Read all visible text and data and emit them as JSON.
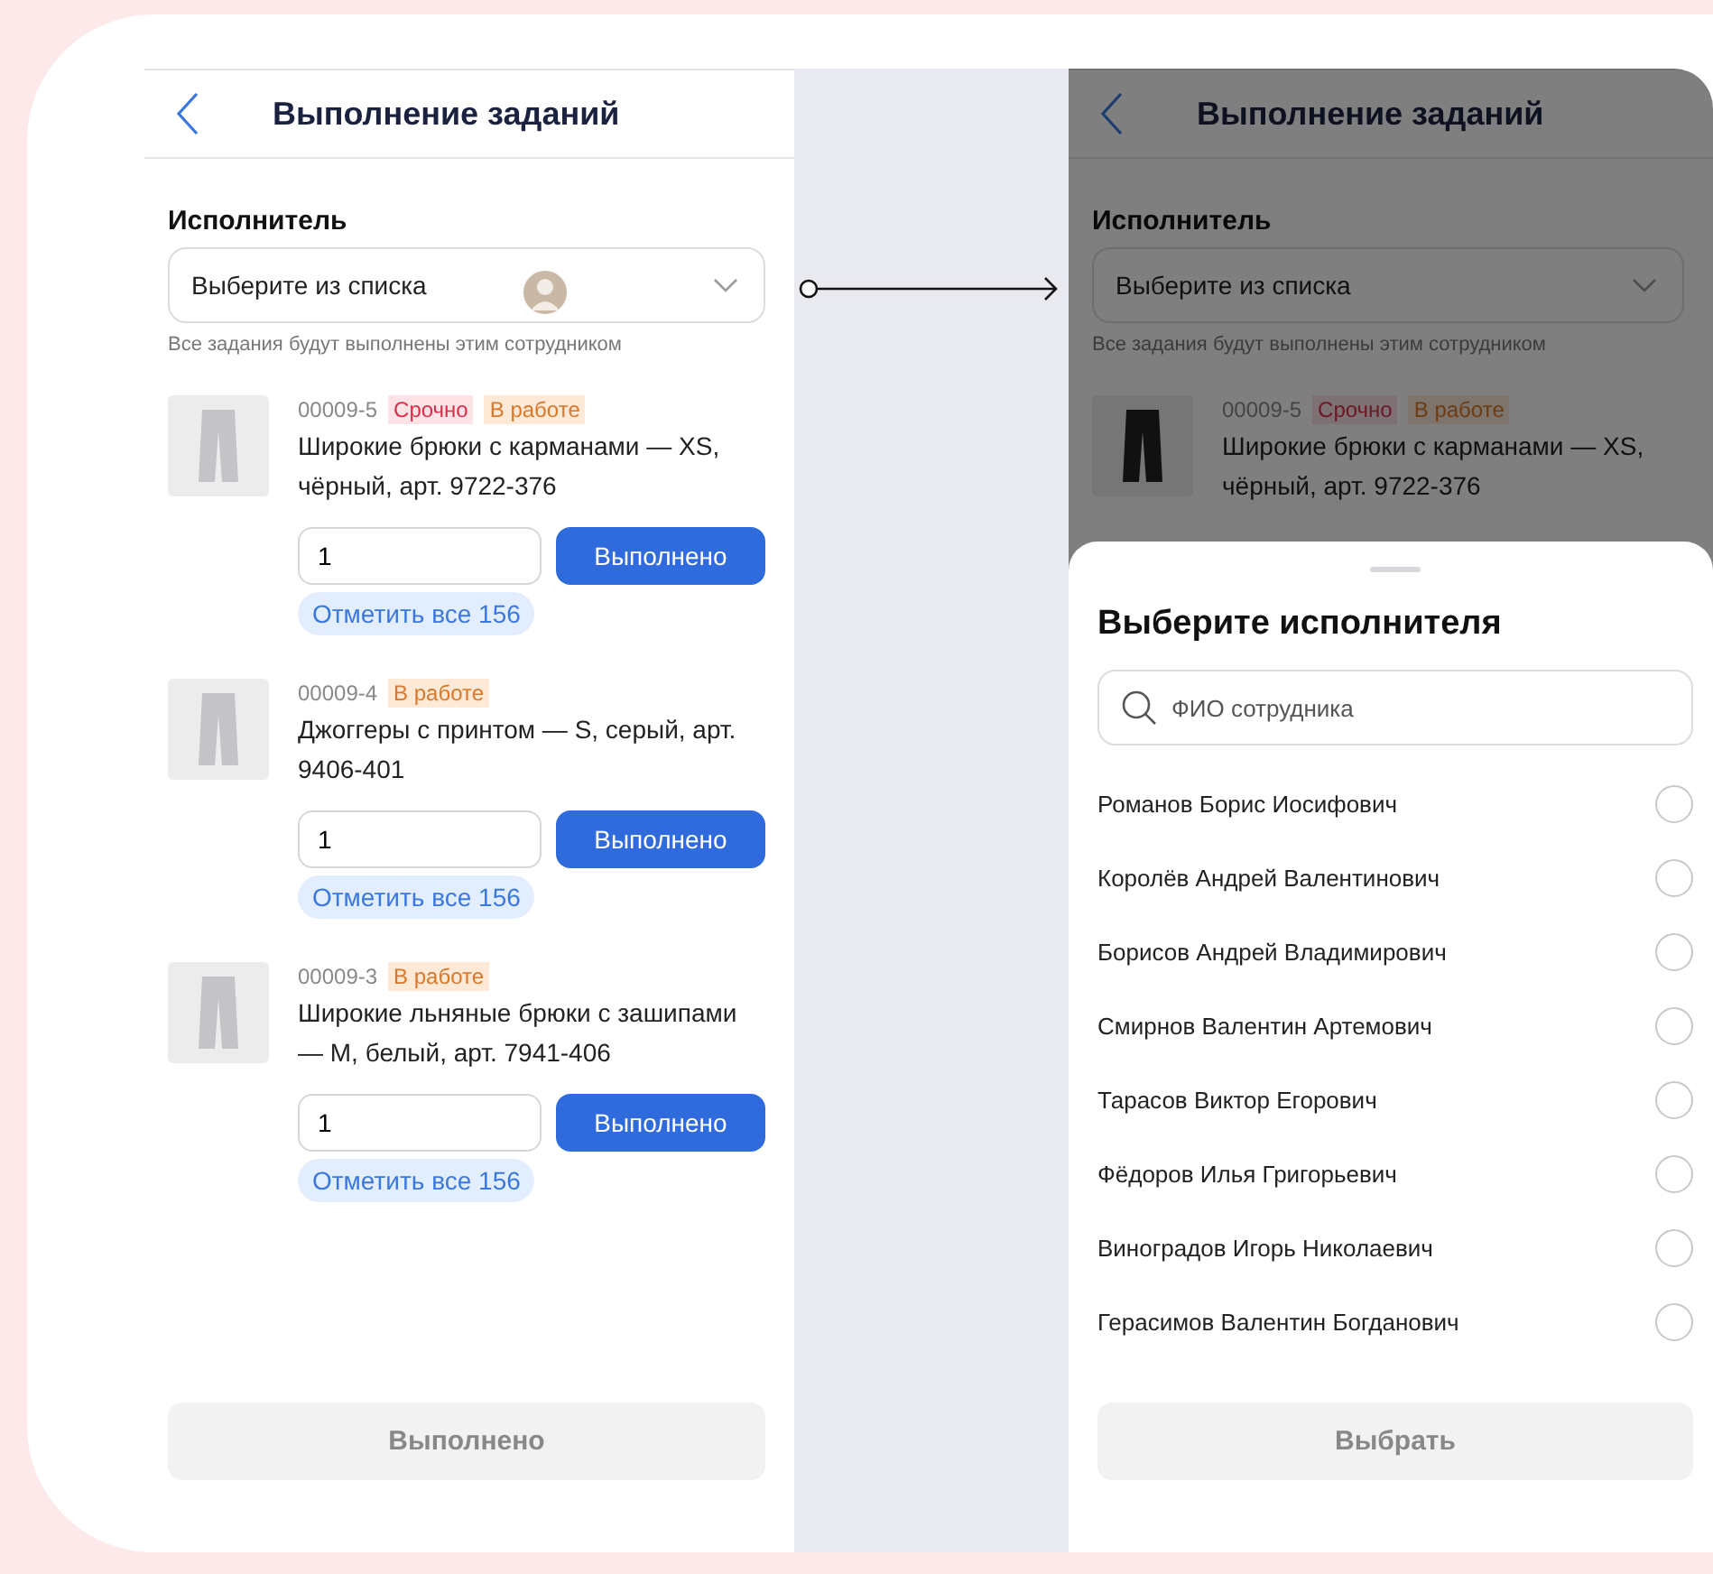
{
  "left_screen": {
    "title": "Выполнение заданий",
    "executor": {
      "label": "Исполнитель",
      "placeholder": "Выберите из списка",
      "hint": "Все задания будут выполнены этим сотрудником"
    },
    "tasks": [
      {
        "code": "00009-5",
        "tags": [
          {
            "label": "Срочно",
            "kind": "urgent"
          },
          {
            "label": "В работе",
            "kind": "progress"
          }
        ],
        "name": "Широкие брюки с карманами — XS, чёрный, арт. 9722-376",
        "quantity": "1",
        "done_button": "Выполнено",
        "mark_all": "Отметить все 156"
      },
      {
        "code": "00009-4",
        "tags": [
          {
            "label": "В работе",
            "kind": "progress"
          }
        ],
        "name": "Джоггеры с принтом — S, серый, арт. 9406-401",
        "quantity": "1",
        "done_button": "Выполнено",
        "mark_all": "Отметить все 156"
      },
      {
        "code": "00009-3",
        "tags": [
          {
            "label": "В работе",
            "kind": "progress"
          }
        ],
        "name": "Широкие льняные брюки с зашипами — M, белый, арт. 7941-406",
        "quantity": "1",
        "done_button": "Выполнено",
        "mark_all": "Отметить все 156"
      }
    ],
    "submit": {
      "label": "Выполнено",
      "disabled": true
    }
  },
  "right_screen": {
    "title": "Выполнение заданий",
    "executor": {
      "label": "Исполнитель",
      "placeholder": "Выберите из списка",
      "hint": "Все задания будут выполнены этим сотрудником"
    },
    "tasks": [
      {
        "code": "00009-5",
        "tags": [
          {
            "label": "Срочно",
            "kind": "urgent"
          },
          {
            "label": "В работе",
            "kind": "progress"
          }
        ],
        "name": "Широкие брюки с карманами — XS, чёрный, арт. 9722-376"
      }
    ],
    "sheet": {
      "title": "Выберите исполнителя",
      "search_placeholder": "ФИО сотрудника",
      "employees": [
        {
          "name": "Романов Борис Иосифович",
          "selected": false
        },
        {
          "name": "Королёв Андрей Валентинович",
          "selected": false
        },
        {
          "name": "Борисов Андрей Владимирович",
          "selected": false
        },
        {
          "name": "Смирнов Валентин Артемович",
          "selected": false
        },
        {
          "name": "Тарасов Виктор Егорович",
          "selected": false
        },
        {
          "name": "Фёдоров Илья Григорьевич",
          "selected": false
        },
        {
          "name": "Виноградов Игорь Николаевич",
          "selected": false
        },
        {
          "name": "Герасимов Валентин Богданович",
          "selected": false
        }
      ],
      "button": {
        "label": "Выбрать",
        "disabled": true
      }
    }
  }
}
